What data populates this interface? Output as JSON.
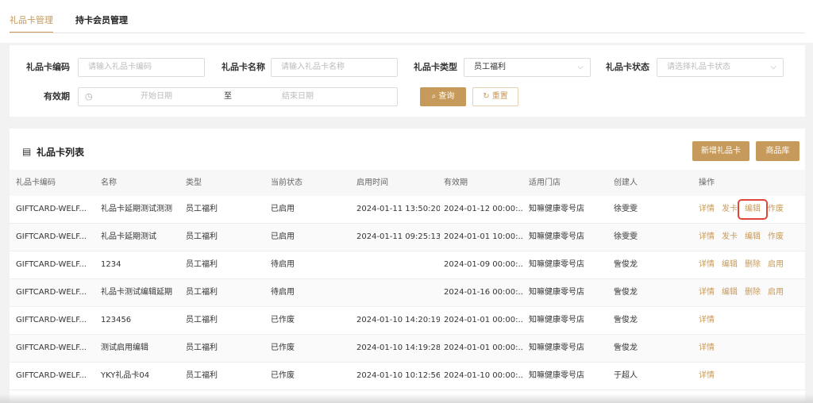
{
  "tabs": [
    {
      "label": "礼品卡管理",
      "active": true
    },
    {
      "label": "持卡会员管理",
      "active": false
    }
  ],
  "filters": {
    "code_label": "礼品卡编码",
    "code_placeholder": "请输入礼品卡编码",
    "name_label": "礼品卡名称",
    "name_placeholder": "请输入礼品卡名称",
    "type_label": "礼品卡类型",
    "type_value": "员工福利",
    "status_label": "礼品卡状态",
    "status_placeholder": "请选择礼品卡状态",
    "validity_label": "有效期",
    "start_placeholder": "开始日期",
    "range_sep": "至",
    "end_placeholder": "结束日期",
    "query_label": "查询",
    "reset_label": "重置"
  },
  "list": {
    "title": "礼品卡列表",
    "add_button": "新增礼品卡",
    "goods_button": "商品库",
    "columns": [
      "礼品卡编码",
      "名称",
      "类型",
      "当前状态",
      "启用时间",
      "有效期",
      "适用门店",
      "创建人",
      "操作"
    ],
    "rows": [
      {
        "code": "GIFTCARD-WELF...",
        "name": "礼品卡延期测试测测",
        "type": "员工福利",
        "status": "已启用",
        "enabled_at": "2024-01-11 13:50:20",
        "valid_until": "2024-01-12 00:00:...",
        "store": "知嘛健康零号店",
        "creator": "徐雯雯",
        "ops": [
          "详情",
          "发卡",
          "编辑",
          "作废"
        ]
      },
      {
        "code": "GIFTCARD-WELF...",
        "name": "礼品卡延期测试",
        "type": "员工福利",
        "status": "已启用",
        "enabled_at": "2024-01-11 09:25:13",
        "valid_until": "2024-01-01 10:00:...",
        "store": "知嘛健康零号店",
        "creator": "徐雯雯",
        "ops": [
          "详情",
          "发卡",
          "编辑",
          "作废"
        ]
      },
      {
        "code": "GIFTCARD-WELF...",
        "name": "1234",
        "type": "员工福利",
        "status": "待启用",
        "enabled_at": "",
        "valid_until": "2024-01-09 00:00:...",
        "store": "知嘛健康零号店",
        "creator": "訾俊龙",
        "ops": [
          "详情",
          "编辑",
          "删除",
          "启用"
        ]
      },
      {
        "code": "GIFTCARD-WELF...",
        "name": "礼品卡测试编辑延期",
        "type": "员工福利",
        "status": "待启用",
        "enabled_at": "",
        "valid_until": "2024-01-16 00:00:...",
        "store": "知嘛健康零号店",
        "creator": "訾俊龙",
        "ops": [
          "详情",
          "编辑",
          "删除",
          "启用"
        ]
      },
      {
        "code": "GIFTCARD-WELF...",
        "name": "123456",
        "type": "员工福利",
        "status": "已作废",
        "enabled_at": "2024-01-10 14:20:19",
        "valid_until": "2024-01-01 00:00:...",
        "store": "知嘛健康零号店",
        "creator": "訾俊龙",
        "ops": [
          "详情"
        ]
      },
      {
        "code": "GIFTCARD-WELF...",
        "name": "测试启用编辑",
        "type": "员工福利",
        "status": "已作废",
        "enabled_at": "2024-01-10 14:19:28",
        "valid_until": "2024-01-01 00:00:...",
        "store": "知嘛健康零号店",
        "creator": "訾俊龙",
        "ops": [
          "详情"
        ]
      },
      {
        "code": "GIFTCARD-WELF...",
        "name": "YKY礼品卡04",
        "type": "员工福利",
        "status": "已作废",
        "enabled_at": "2024-01-10 10:12:56",
        "valid_until": "2024-01-10 00:00:...",
        "store": "知嘛健康零号店",
        "creator": "于超人",
        "ops": [
          "详情"
        ]
      }
    ]
  },
  "colors": {
    "accent": "#c69a5b",
    "highlight": "#e0453a"
  }
}
